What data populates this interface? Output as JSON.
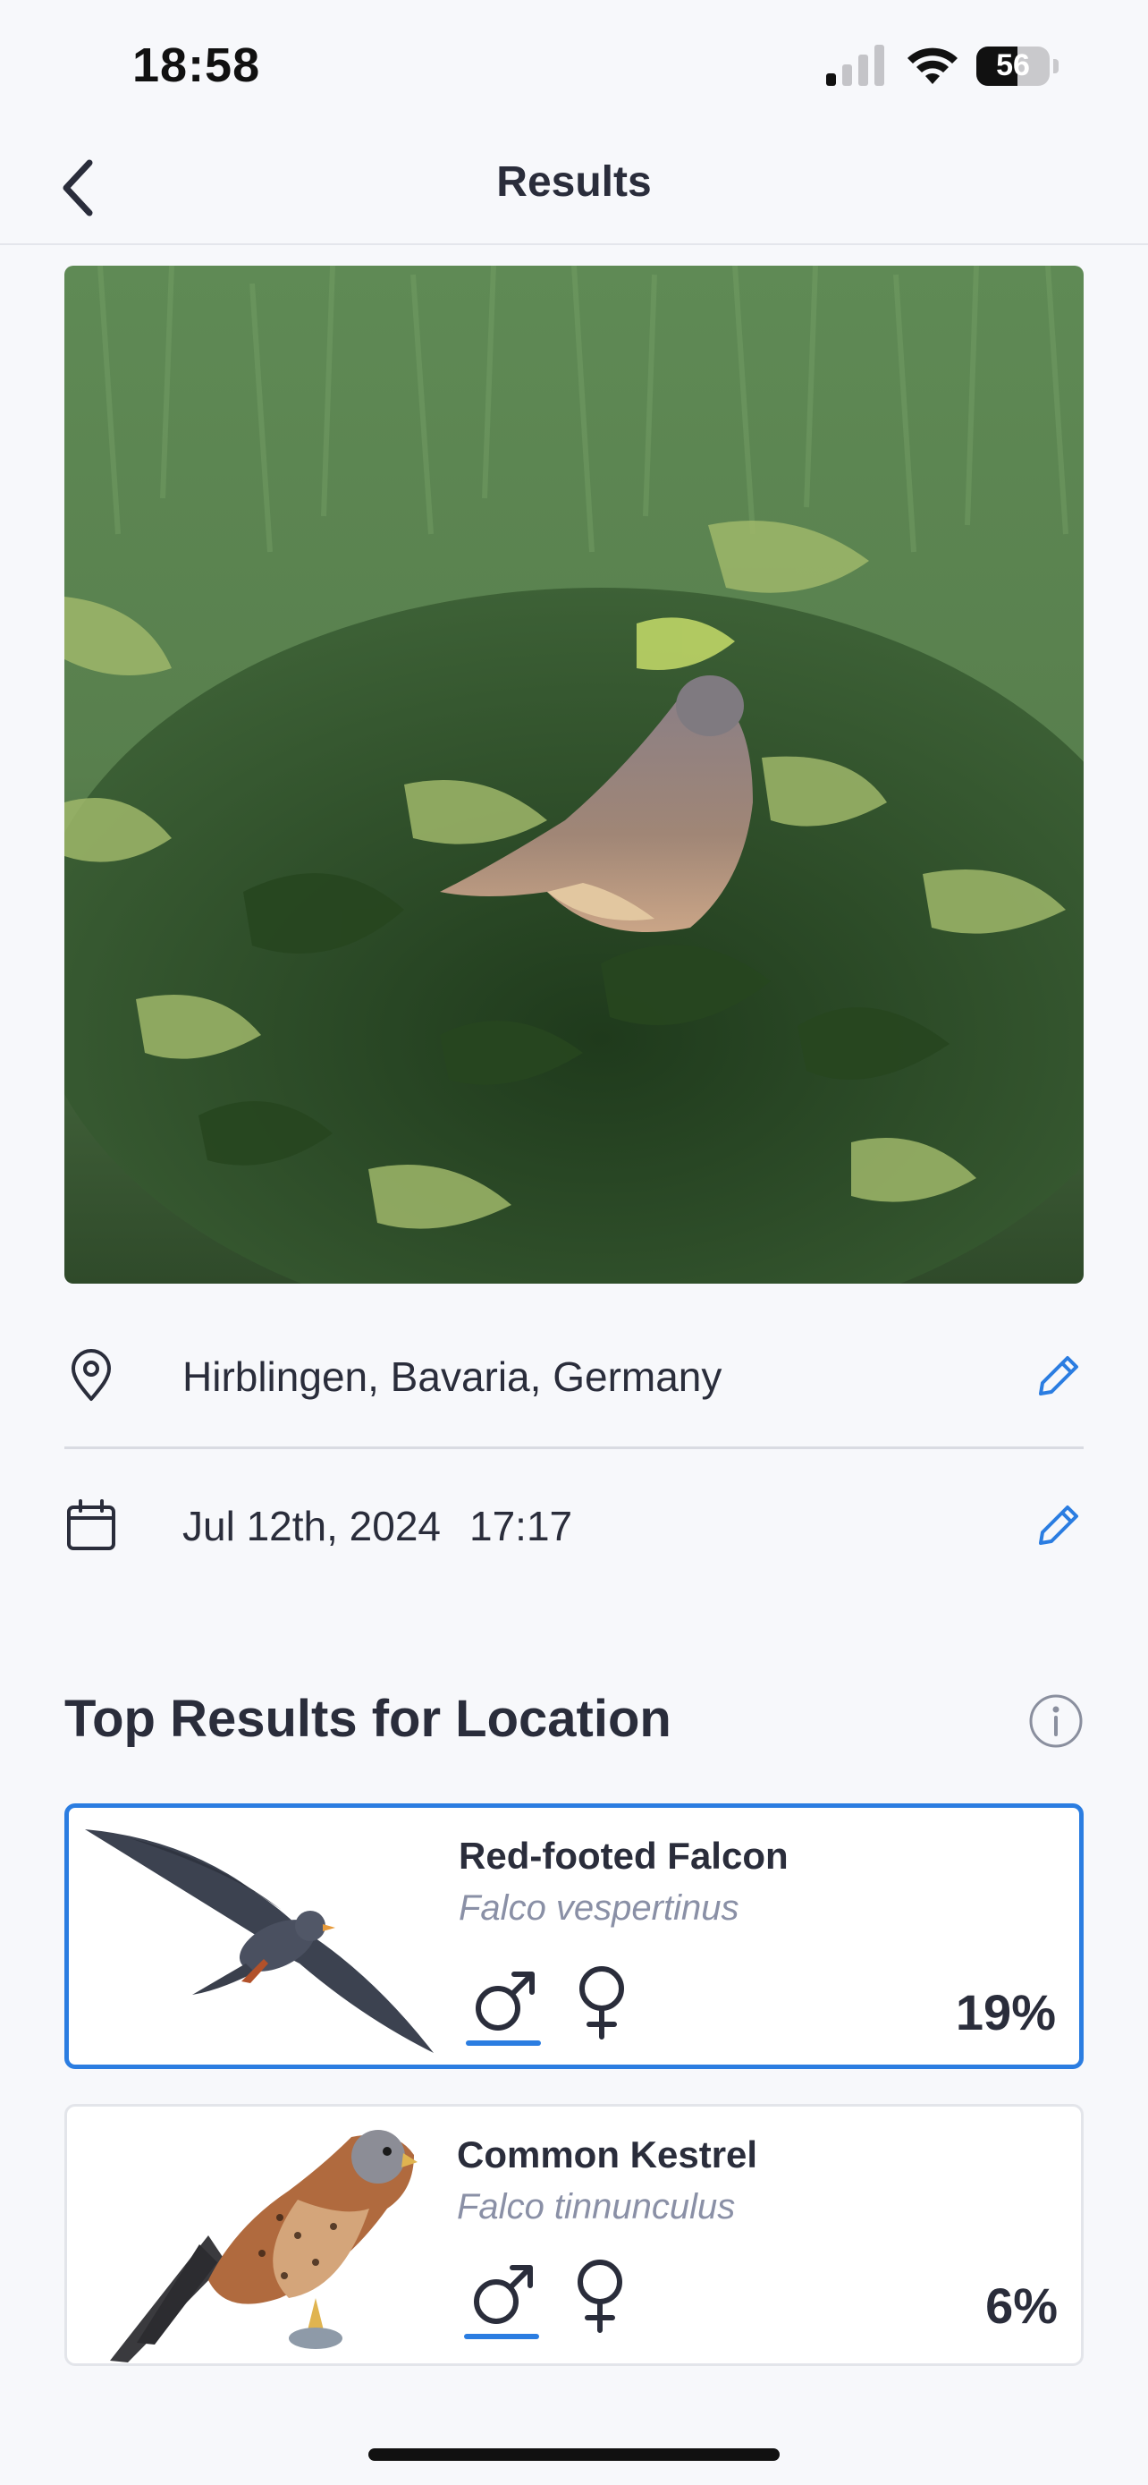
{
  "status_bar": {
    "time": "18:58",
    "battery_level": "56",
    "battery_fraction": 0.56
  },
  "nav": {
    "title": "Results",
    "back_icon": "chevron-left-icon"
  },
  "photo": {
    "icon": "photo-bird-in-bush"
  },
  "location": {
    "icon": "map-pin-icon",
    "text": "Hirblingen, Bavaria, Germany",
    "edit_icon": "pencil-icon"
  },
  "datetime": {
    "icon": "calendar-icon",
    "date": "Jul 12th, 2024",
    "time": "17:17",
    "edit_icon": "pencil-icon"
  },
  "results": {
    "title": "Top Results for Location",
    "info_icon": "info-icon",
    "accent_color": "#2b7de1",
    "items": [
      {
        "name": "Red-footed Falcon",
        "scientific": "Falco vespertinus",
        "percent": "19%",
        "selected": true,
        "selected_sex": "male"
      },
      {
        "name": "Common Kestrel",
        "scientific": "Falco tinnunculus",
        "percent": "6%",
        "selected": false,
        "selected_sex": "male"
      }
    ]
  }
}
